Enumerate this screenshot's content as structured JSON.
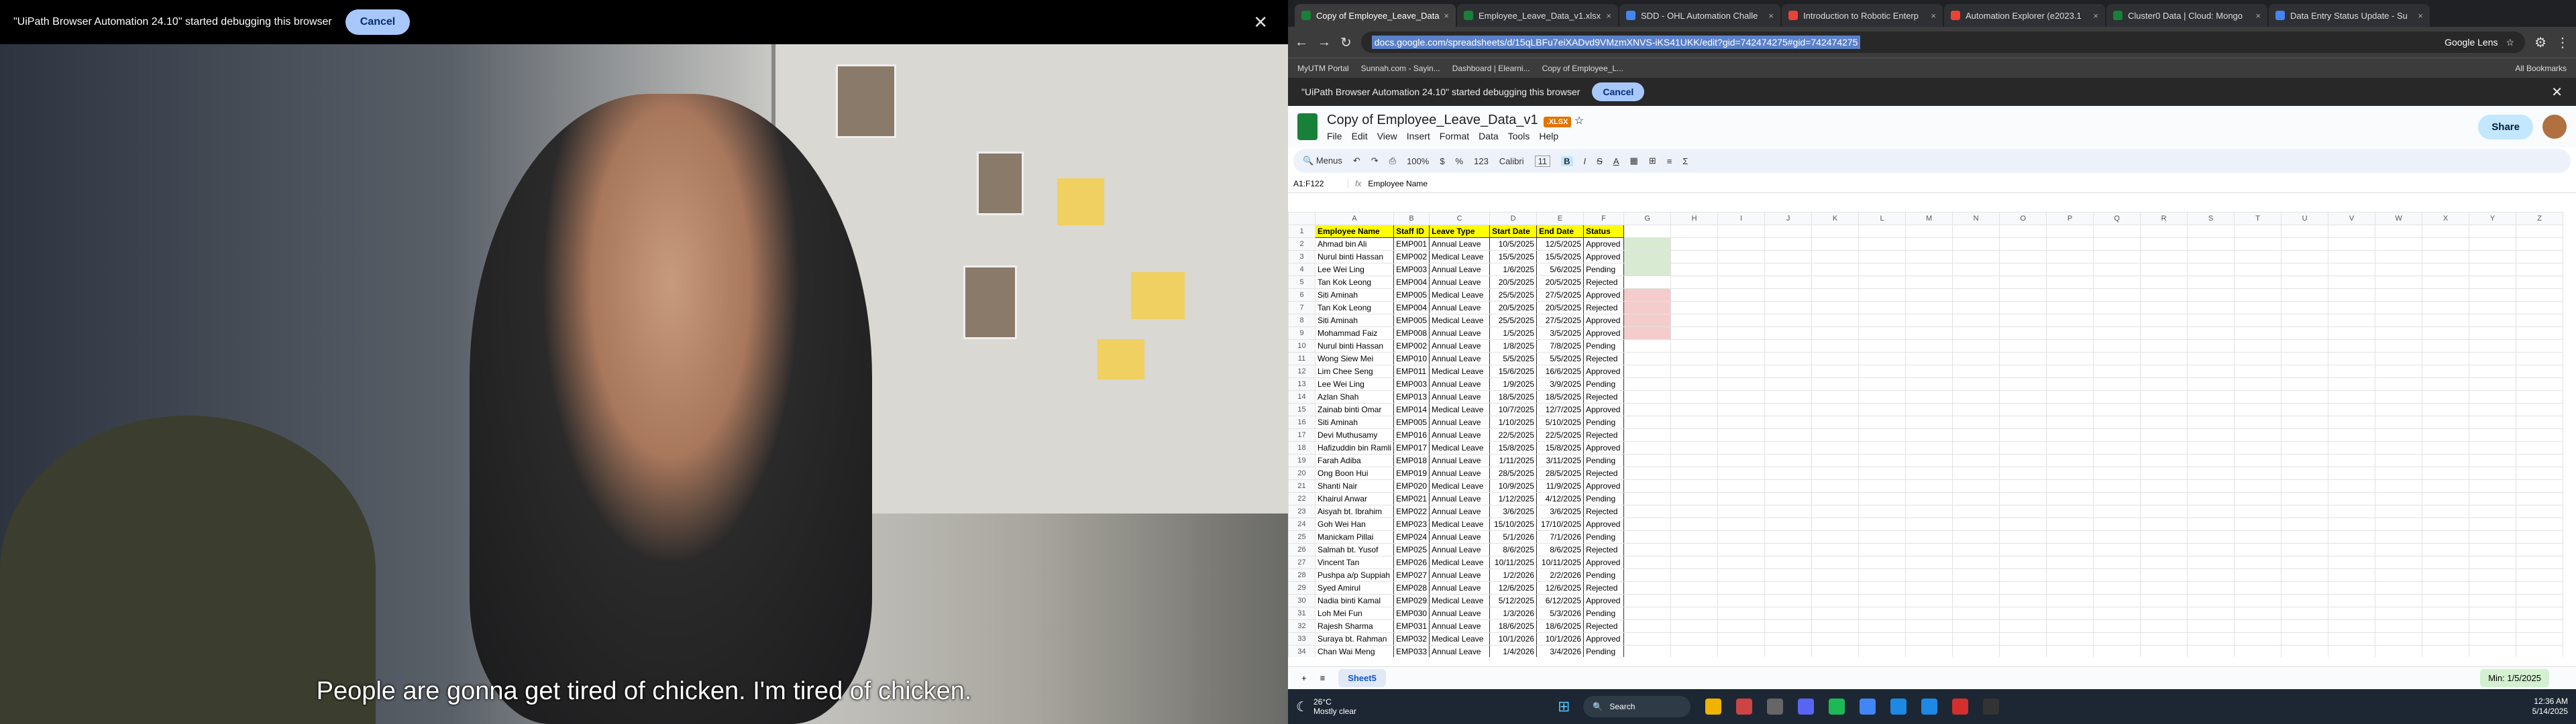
{
  "video": {
    "notice": "\"UiPath Browser Automation 24.10\" started debugging this browser",
    "cancel": "Cancel",
    "subtitle": "People are gonna get tired of chicken. I'm tired of chicken."
  },
  "browser": {
    "tabs": [
      {
        "label": "Copy of Employee_Leave_Data",
        "color": "#188038",
        "active": true
      },
      {
        "label": "Employee_Leave_Data_v1.xlsx",
        "color": "#188038"
      },
      {
        "label": "SDD - OHL Automation Challe",
        "color": "#4285f4"
      },
      {
        "label": "Introduction to Robotic Enterp",
        "color": "#ea4335"
      },
      {
        "label": "Automation Explorer (e2023.1",
        "color": "#ea4335"
      },
      {
        "label": "Cluster0 Data | Cloud: Mongo",
        "color": "#188038"
      },
      {
        "label": "Data Entry Status Update - Su",
        "color": "#4285f4"
      }
    ],
    "url": "docs.google.com/spreadsheets/d/15qLBFu7eiXADvd9VMzmXNVS-iKS41UKK/edit?gid=742474275#gid=742474275",
    "lens": "Google Lens",
    "bookmarks": [
      "MyUTM Portal",
      "Sunnah.com - Sayin...",
      "Dashboard | Elearni...",
      "Copy of Employee_L..."
    ],
    "all_bookmarks": "All Bookmarks",
    "debug_notice": "\"UiPath Browser Automation 24.10\" started debugging this browser",
    "debug_cancel": "Cancel"
  },
  "sheet": {
    "doc_title": "Copy of Employee_Leave_Data_v1",
    "ext": ".XLSX",
    "menus": [
      "File",
      "Edit",
      "View",
      "Insert",
      "Format",
      "Data",
      "Tools",
      "Help"
    ],
    "share": "Share",
    "toolbar": {
      "menus": "Menus",
      "zoom": "100%",
      "font": "Calibri",
      "size": "11",
      "currency": "$",
      "percent": "%",
      "numfmt": "123"
    },
    "cell_ref": "A1:F122",
    "formula": "Employee Name",
    "columns": [
      "A",
      "B",
      "C",
      "D",
      "E",
      "F",
      "G",
      "H",
      "I",
      "J",
      "K",
      "L",
      "M",
      "N",
      "O",
      "P",
      "Q",
      "R",
      "S",
      "T",
      "U",
      "V",
      "W",
      "X",
      "Y",
      "Z"
    ],
    "headers": [
      "Employee Name",
      "Staff ID",
      "Leave Type",
      "Start Date",
      "End Date",
      "Status"
    ],
    "rows": [
      [
        "Ahmad bin Ali",
        "EMP001",
        "Annual Leave",
        "10/5/2025",
        "12/5/2025",
        "Approved"
      ],
      [
        "Nurul binti Hassan",
        "EMP002",
        "Medical Leave",
        "15/5/2025",
        "15/5/2025",
        "Approved"
      ],
      [
        "Lee Wei Ling",
        "EMP003",
        "Annual Leave",
        "1/6/2025",
        "5/6/2025",
        "Pending"
      ],
      [
        "Tan Kok Leong",
        "EMP004",
        "Annual Leave",
        "20/5/2025",
        "20/5/2025",
        "Rejected"
      ],
      [
        "Siti Aminah",
        "EMP005",
        "Medical Leave",
        "25/5/2025",
        "27/5/2025",
        "Approved"
      ],
      [
        "Tan Kok Leong",
        "EMP004",
        "Annual Leave",
        "20/5/2025",
        "20/5/2025",
        "Rejected"
      ],
      [
        "Siti Aminah",
        "EMP005",
        "Medical Leave",
        "25/5/2025",
        "27/5/2025",
        "Approved"
      ],
      [
        "Mohammad Faiz",
        "EMP008",
        "Annual Leave",
        "1/5/2025",
        "3/5/2025",
        "Approved"
      ],
      [
        "Nurul binti Hassan",
        "EMP002",
        "Annual Leave",
        "1/8/2025",
        "7/8/2025",
        "Pending"
      ],
      [
        "Wong Siew Mei",
        "EMP010",
        "Annual Leave",
        "5/5/2025",
        "5/5/2025",
        "Rejected"
      ],
      [
        "Lim Chee Seng",
        "EMP011",
        "Medical Leave",
        "15/6/2025",
        "16/6/2025",
        "Approved"
      ],
      [
        "Lee Wei Ling",
        "EMP003",
        "Annual Leave",
        "1/9/2025",
        "3/9/2025",
        "Pending"
      ],
      [
        "Azlan Shah",
        "EMP013",
        "Annual Leave",
        "18/5/2025",
        "18/5/2025",
        "Rejected"
      ],
      [
        "Zainab binti Omar",
        "EMP014",
        "Medical Leave",
        "10/7/2025",
        "12/7/2025",
        "Approved"
      ],
      [
        "Siti Aminah",
        "EMP005",
        "Annual Leave",
        "1/10/2025",
        "5/10/2025",
        "Pending"
      ],
      [
        "Devi Muthusamy",
        "EMP016",
        "Annual Leave",
        "22/5/2025",
        "22/5/2025",
        "Rejected"
      ],
      [
        "Hafizuddin bin Ramli",
        "EMP017",
        "Medical Leave",
        "15/8/2025",
        "15/8/2025",
        "Approved"
      ],
      [
        "Farah Adiba",
        "EMP018",
        "Annual Leave",
        "1/11/2025",
        "3/11/2025",
        "Pending"
      ],
      [
        "Ong Boon Hui",
        "EMP019",
        "Annual Leave",
        "28/5/2025",
        "28/5/2025",
        "Rejected"
      ],
      [
        "Shanti Nair",
        "EMP020",
        "Medical Leave",
        "10/9/2025",
        "11/9/2025",
        "Approved"
      ],
      [
        "Khairul Anwar",
        "EMP021",
        "Annual Leave",
        "1/12/2025",
        "4/12/2025",
        "Pending"
      ],
      [
        "Aisyah bt. Ibrahim",
        "EMP022",
        "Annual Leave",
        "3/6/2025",
        "3/6/2025",
        "Rejected"
      ],
      [
        "Goh Wei Han",
        "EMP023",
        "Medical Leave",
        "15/10/2025",
        "17/10/2025",
        "Approved"
      ],
      [
        "Manickam Pillai",
        "EMP024",
        "Annual Leave",
        "5/1/2026",
        "7/1/2026",
        "Pending"
      ],
      [
        "Salmah bt. Yusof",
        "EMP025",
        "Annual Leave",
        "8/6/2025",
        "8/6/2025",
        "Rejected"
      ],
      [
        "Vincent Tan",
        "EMP026",
        "Medical Leave",
        "10/11/2025",
        "10/11/2025",
        "Approved"
      ],
      [
        "Pushpa a/p Suppiah",
        "EMP027",
        "Annual Leave",
        "1/2/2026",
        "2/2/2026",
        "Pending"
      ],
      [
        "Syed Amirul",
        "EMP028",
        "Annual Leave",
        "12/6/2025",
        "12/6/2025",
        "Rejected"
      ],
      [
        "Nadia binti Kamal",
        "EMP029",
        "Medical Leave",
        "5/12/2025",
        "6/12/2025",
        "Approved"
      ],
      [
        "Loh Mei Fun",
        "EMP030",
        "Annual Leave",
        "1/3/2026",
        "5/3/2026",
        "Pending"
      ],
      [
        "Rajesh Sharma",
        "EMP031",
        "Annual Leave",
        "18/6/2025",
        "18/6/2025",
        "Rejected"
      ],
      [
        "Suraya bt. Rahman",
        "EMP032",
        "Medical Leave",
        "10/1/2026",
        "10/1/2026",
        "Approved"
      ],
      [
        "Chan Wai Meng",
        "EMP033",
        "Annual Leave",
        "1/4/2026",
        "3/4/2026",
        "Pending"
      ]
    ],
    "sheet_tab": "Sheet5",
    "summary": "Min: 1/5/2025"
  },
  "taskbar": {
    "temp": "26°C",
    "weather": "Mostly clear",
    "search": "Search",
    "time": "12:36 AM",
    "date": "5/14/2025",
    "app_colors": [
      "#f0b400",
      "#c44",
      "#666",
      "#5865f2",
      "#1db954",
      "#4285f4",
      "#1e88e5",
      "#1e88e5",
      "#d32f2f",
      "#333"
    ]
  }
}
